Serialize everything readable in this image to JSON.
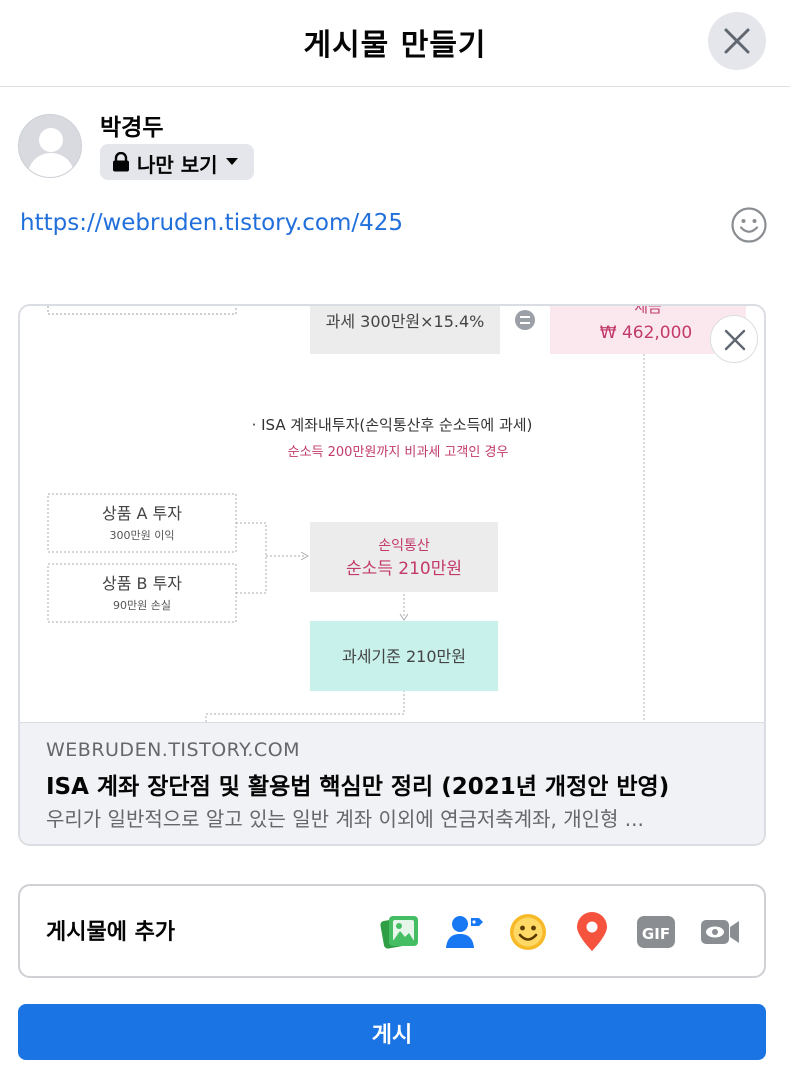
{
  "header": {
    "title": "게시물 만들기"
  },
  "user": {
    "name": "박경두"
  },
  "privacy": {
    "label": "나만 보기"
  },
  "post": {
    "text": "https://webruden.tistory.com/425"
  },
  "link_preview": {
    "image_texts": {
      "tax_formula": "과세 300만원×15.4%",
      "tax_top": "세금",
      "tax_amount": "₩ 462,000",
      "isa_heading": "· ISA 계좌내투자(손익통산후 순소득에 과세)",
      "isa_sub": "순소득 200만원까지 비과세 고객인 경우",
      "product_a": "상품 A 투자",
      "product_a_sub": "300만원 이익",
      "product_b": "상품 B 투자",
      "product_b_sub": "90만원 손실",
      "net_line1": "손익통산",
      "net_line2": "순소득 210만원",
      "tax_base": "과세기준 210만원"
    },
    "domain": "WEBRUDEN.TISTORY.COM",
    "title": "ISA 계좌 장단점 및 활용법 핵심만 정리 (2021년 개정안 반영)",
    "description": "우리가 일반적으로 알고 있는 일반 계좌 이외에 연금저축계좌, 개인형 ..."
  },
  "add_to_post": {
    "label": "게시물에 추가",
    "icons": [
      "photo-video-icon",
      "tag-people-icon",
      "feeling-icon",
      "check-in-icon",
      "gif-icon",
      "live-video-icon"
    ]
  },
  "submit": {
    "label": "게시"
  },
  "colors": {
    "accent": "#1b74e4",
    "link": "#216fdb",
    "photo_green": "#45bd62",
    "tag_blue": "#1877f2",
    "feeling_yellow": "#f7b928",
    "checkin_red": "#f5533d",
    "gif_gray": "#8a8d91"
  }
}
